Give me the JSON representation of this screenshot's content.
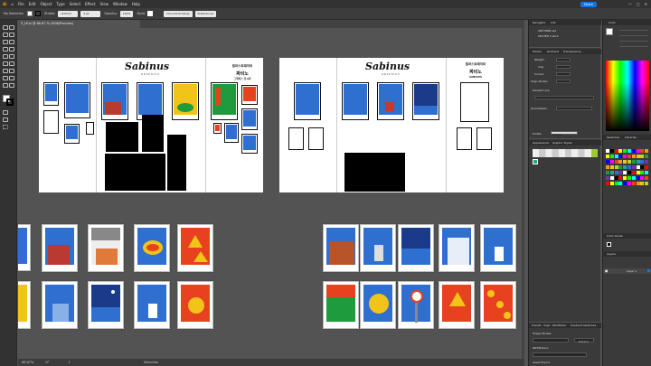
{
  "menubar": {
    "items": [
      "File",
      "Edit",
      "Object",
      "Type",
      "Select",
      "Effect",
      "View",
      "Window",
      "Help"
    ],
    "share_label": "Share"
  },
  "controlbar": {
    "selection": "No Selection",
    "stroke_label": "Stroke:",
    "stroke_style": "Uniform",
    "brush": "5 pt. Round",
    "opacity_label": "Opacity:",
    "opacity_value": "100%",
    "style_label": "Style:",
    "doc_setup": "Document Setup",
    "preferences": "Preferences"
  },
  "document": {
    "tab_title": "5_LP.ai @ 66.67 % (RGB/Preview)"
  },
  "artboards": {
    "logo": "Sabinus",
    "logo_sub": "GRAPHICS",
    "korean_title": "일러스트레이터",
    "korean_line2": "짜비노",
    "korean_line3": "그래픽스 전시회",
    "korean_line4": "SABINUS"
  },
  "statusbar": {
    "zoom": "66.67%",
    "angle": "0°",
    "artboard_num": "1",
    "tool": "Selection"
  },
  "midpanel": {
    "tabs_top": [
      "Navigator",
      "Info"
    ],
    "layers_rows": [
      "ART.MOBI.ssd",
      "POSTER 2 stick"
    ],
    "tabs_props": [
      "Stroke",
      "Gradient",
      "Transparency"
    ],
    "stroke_fields": [
      "Weight:",
      "Cap:",
      "Corner:",
      "Align Stroke:"
    ],
    "dashed_label": "Dashed Line",
    "arrowheads_label": "Arrowheads:",
    "profile_label": "Profile:",
    "profile_value": "Uniform",
    "tabs_appearance": [
      "Appearance",
      "Graphic Styles"
    ],
    "tabs_bottom": [
      "Transfo",
      "Align",
      "Pathfinder",
      "Gradient",
      "Swatches"
    ],
    "shape_modes": "Shape Modes:",
    "pathfinders": "Pathfinders:",
    "expand": "Expand",
    "export_label": "Asset Export"
  },
  "rightpanel": {
    "color_tab": "Color",
    "swatches_tab": "Swatches",
    "libraries_tab": "Libraries",
    "color_guide_tab": "Color Guide",
    "layers_tab": "Layers",
    "layer_name": "Layer 1"
  },
  "colors": {
    "accent": "#1473e6",
    "poster_blue": "#2f6fd0",
    "poster_red": "#e8411f",
    "poster_green": "#1e9b3c",
    "poster_yellow": "#f2c318"
  }
}
